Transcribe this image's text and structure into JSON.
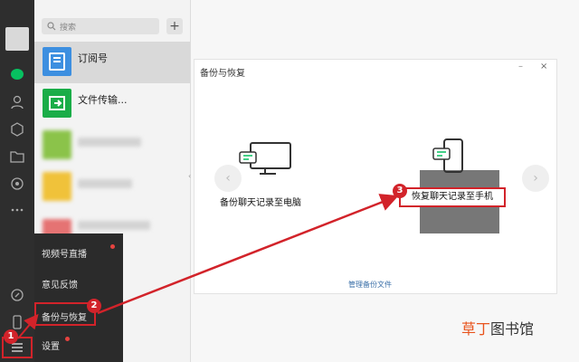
{
  "sidebar": {
    "icons": [
      "chat-icon",
      "contacts-icon",
      "favorites-icon",
      "files-icon",
      "moments-icon",
      "more-icon",
      "mini-program-icon",
      "phone-icon",
      "menu-icon"
    ]
  },
  "chatlist": {
    "search_placeholder": "搜索",
    "add_label": "+",
    "items": [
      {
        "name": "订阅号"
      },
      {
        "name": "文件传输..."
      }
    ]
  },
  "menu": {
    "items": [
      {
        "label": "视频号直播"
      },
      {
        "label": "意见反馈"
      },
      {
        "label": "备份与恢复"
      },
      {
        "label": "设置"
      }
    ]
  },
  "dialog": {
    "title": "备份与恢复",
    "min_label": "–",
    "close_label": "×",
    "backup_label": "备份聊天记录至电脑",
    "restore_label": "恢复聊天记录至手机",
    "manage_label": "管理备份文件",
    "prev_label": "‹",
    "next_label": "›"
  },
  "annotations": {
    "step1": "1",
    "step2": "2",
    "step3": "3"
  },
  "collapse_label": "‹",
  "watermark": {
    "part1": "草丁",
    "part2": "图书馆"
  },
  "colors": {
    "highlight": "#d2232a",
    "rail": "#2e2e2e",
    "menu": "#2b2b2b",
    "watermark_accent": "#e8541e"
  }
}
